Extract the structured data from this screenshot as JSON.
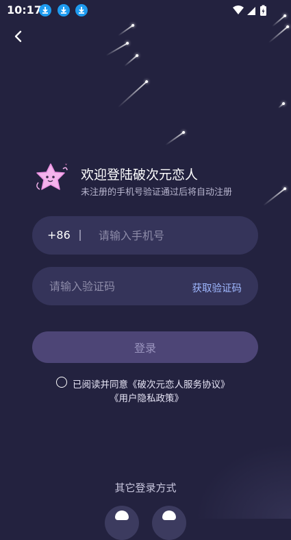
{
  "status_bar": {
    "time": "10:17",
    "download_icons": [
      "download-icon",
      "download-icon",
      "download-icon"
    ],
    "system_icons": [
      "wifi-icon",
      "signal-icon",
      "battery-charging-icon"
    ]
  },
  "nav": {
    "back_icon": "chevron-left-icon"
  },
  "header": {
    "mascot_icon": "star-mascot-icon",
    "title": "欢迎登陆破次元恋人",
    "subtitle": "未注册的手机号验证通过后将自动注册"
  },
  "phone_field": {
    "country_code": "+86",
    "placeholder": "请输入手机号",
    "value": ""
  },
  "code_field": {
    "placeholder": "请输入验证码",
    "value": "",
    "get_code_label": "获取验证码"
  },
  "login_button": {
    "label": "登录"
  },
  "agreement": {
    "checked": false,
    "prefix": "已阅读并同意",
    "service_link": "《破次元恋人服务协议》",
    "privacy_link": "《用户隐私政策》"
  },
  "other_login": {
    "label": "其它登录方式"
  },
  "colors": {
    "background": "#23223f",
    "field": "#35345a",
    "button": "#4d4576",
    "link": "#9fb8ff",
    "download_badge": "#1e9bf0"
  }
}
